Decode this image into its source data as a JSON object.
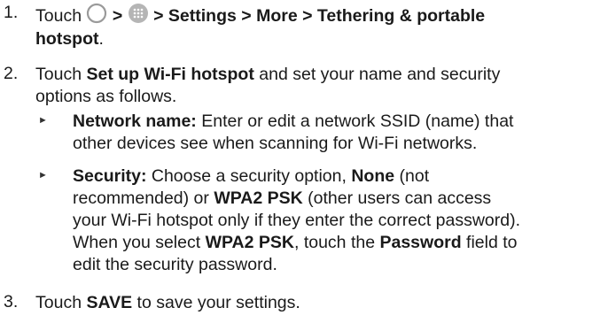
{
  "steps": [
    {
      "num": "1.",
      "pre": "Touch",
      "sep1": ">",
      "path": "> Settings > More > Tethering & portable",
      "line2_bold": "hotspot",
      "line2_rest": ".",
      "icons": [
        "home-circle-icon",
        "apps-grid-icon"
      ]
    },
    {
      "num": "2.",
      "pre": "Touch",
      "bold": "Set up Wi-Fi hotspot",
      "rest": "and set your name and security",
      "line2": "options as follows."
    },
    {
      "num": "3.",
      "pre": "Touch",
      "bold": "SAVE",
      "rest": "to save your settings."
    }
  ],
  "bullets": [
    {
      "label": "Network name:",
      "l1": "Enter or edit a network SSID (name) that",
      "l2": "other devices see when scanning for Wi-Fi networks."
    },
    {
      "label": "Security:",
      "l1_a": "Choose a security option,",
      "l1_none": "None",
      "l1_b": "(not",
      "l2_a": "recommended) or",
      "l2_wpa": "WPA2 PSK",
      "l2_b": "(other users can access",
      "l3": "your Wi-Fi hotspot only if they enter the correct password).",
      "l4_a": "When you select",
      "l4_wpa": "WPA2 PSK",
      "l4_b": ", touch the",
      "l4_pw": "Password",
      "l4_c": "field to",
      "l5": "edit the security password."
    }
  ],
  "bullet_marker": "►",
  "colors": {
    "text": "#1a1a1a",
    "icon": "#9a9a9a"
  }
}
